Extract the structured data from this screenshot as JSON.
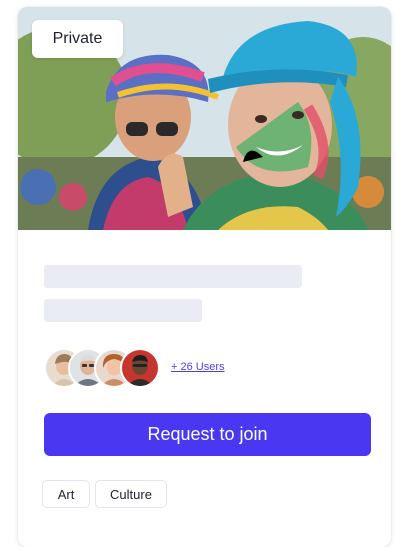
{
  "card": {
    "privacy_label": "Private",
    "hero_image": "holi-festival-photo",
    "members": {
      "avatars": [
        "member-avatar-1",
        "member-avatar-2",
        "member-avatar-3",
        "member-avatar-4"
      ],
      "more_label": "+ 26 Users"
    },
    "join_label": "Request to join",
    "tags": [
      "Art",
      "Culture"
    ]
  },
  "colors": {
    "accent": "#4a37f2",
    "link": "#4a3fe6",
    "skeleton": "#e9ecf3"
  }
}
